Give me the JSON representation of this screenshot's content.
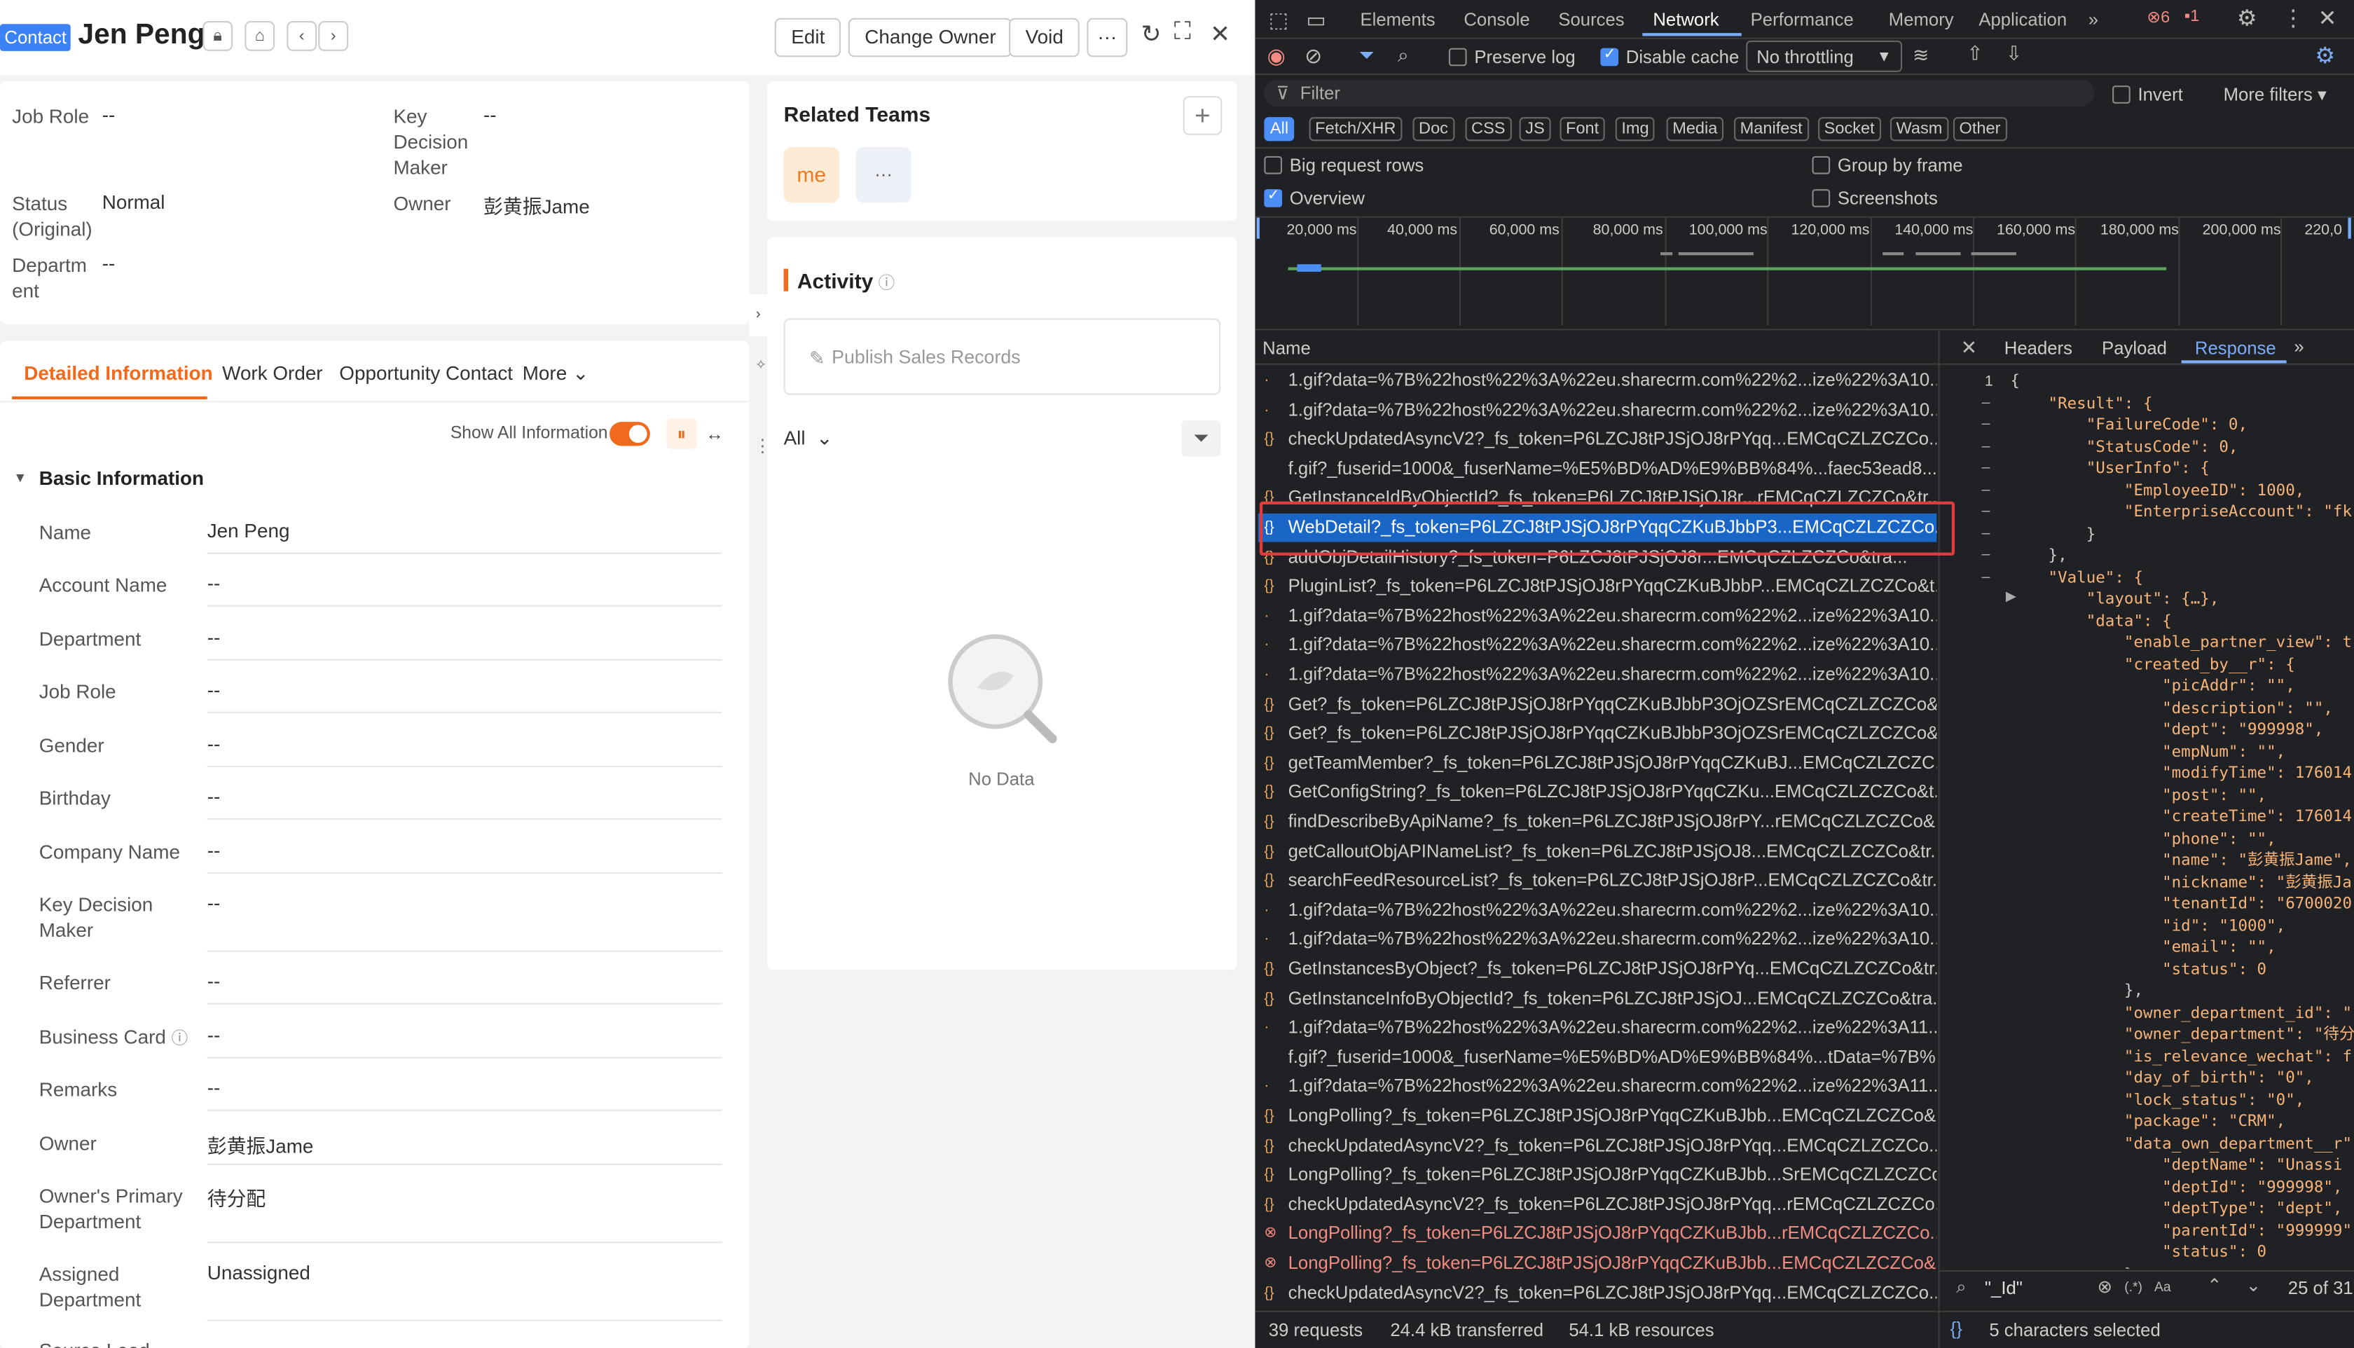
{
  "crm": {
    "type_tag": "Contact",
    "name": "Jen Peng",
    "buttons": {
      "edit": "Edit",
      "change_owner": "Change Owner",
      "void": "Void",
      "more": "···"
    },
    "summary": {
      "job_role_label": "Job Role",
      "job_role_value": "--",
      "key_decision_label": "Key Decision Maker",
      "key_decision_value": "--",
      "status_label": "Status (Original)",
      "status_value": "Normal",
      "owner_label": "Owner",
      "owner_value": "彭黄振Jame",
      "department_label": "Departm ent",
      "department_value": "--"
    },
    "tabs": [
      "Detailed Information",
      "Work Order",
      "Opportunity Contact",
      "More"
    ],
    "show_all_label": "Show All Information",
    "section_title": "Basic Information",
    "fields": [
      {
        "label": "Name",
        "value": "Jen Peng"
      },
      {
        "label": "Account Name",
        "value": "--"
      },
      {
        "label": "Department",
        "value": "--"
      },
      {
        "label": "Job Role",
        "value": "--"
      },
      {
        "label": "Gender",
        "value": "--"
      },
      {
        "label": "Birthday",
        "value": "--"
      },
      {
        "label": "Company Name",
        "value": "--"
      },
      {
        "label": "Key Decision Maker",
        "value": "--"
      },
      {
        "label": "Referrer",
        "value": "--"
      },
      {
        "label": "Business Card",
        "value": "--"
      },
      {
        "label": "Remarks",
        "value": "--"
      },
      {
        "label": "Owner",
        "value": "彭黄振Jame"
      },
      {
        "label": "Owner's Primary Department",
        "value": "待分配"
      },
      {
        "label": "Assigned Department",
        "value": "Unassigned"
      },
      {
        "label": "Source Lead",
        "value": ""
      }
    ],
    "related_teams": {
      "title": "Related Teams",
      "avatar": "me",
      "more": "···",
      "add": "+"
    },
    "activity": {
      "title": "Activity",
      "publish_placeholder": "Publish Sales Records",
      "filter_all": "All",
      "empty": "No Data"
    }
  },
  "devtools": {
    "tabs": [
      "Elements",
      "Console",
      "Sources",
      "Network",
      "Performance",
      "Memory",
      "Application"
    ],
    "active_tab": "Network",
    "badges": {
      "errors": "6",
      "warnings": "1"
    },
    "toolbar": {
      "preserve_log": "Preserve log",
      "disable_cache": "Disable cache",
      "throttling": "No throttling"
    },
    "filter": {
      "placeholder": "Filter",
      "invert": "Invert",
      "more_filters": "More filters"
    },
    "type_filters": [
      "All",
      "Fetch/XHR",
      "Doc",
      "CSS",
      "JS",
      "Font",
      "Img",
      "Media",
      "Manifest",
      "Socket",
      "Wasm",
      "Other"
    ],
    "options": {
      "big_rows": "Big request rows",
      "group_by_frame": "Group by frame",
      "overview": "Overview",
      "screenshots": "Screenshots"
    },
    "timeline_ticks": [
      "20,000 ms",
      "40,000 ms",
      "60,000 ms",
      "80,000 ms",
      "100,000 ms",
      "120,000 ms",
      "140,000 ms",
      "160,000 ms",
      "180,000 ms",
      "200,000 ms",
      "220,0"
    ],
    "list_header": "Name",
    "requests": [
      {
        "name": "1.gif?data=%7B%22host%22%3A%22eu.sharecrm.com%22%2...ize%22%3A10...",
        "kind": "plain"
      },
      {
        "name": "1.gif?data=%7B%22host%22%3A%22eu.sharecrm.com%22%2...ize%22%3A10...",
        "kind": "plain"
      },
      {
        "name": "checkUpdatedAsyncV2?_fs_token=P6LZCJ8tPJSjOJ8rPYqq...EMCqCZLZCZCo...",
        "kind": "xhr"
      },
      {
        "name": "f.gif?_fuserid=1000&_fuserName=%E5%BD%AD%E9%BB%84%...faec53ead8...",
        "kind": "plain"
      },
      {
        "name": "GetInstanceIdByObjectId?_fs_token=P6LZCJ8tPJSjOJ8r...rEMCqCZLZCZCo&tr...",
        "kind": "xhr"
      },
      {
        "name": "WebDetail?_fs_token=P6LZCJ8tPJSjOJ8rPYqqCZKuBJbbP3...EMCqCZLZCZCo...",
        "kind": "selected"
      },
      {
        "name": "addObjDetailHistory?_fs_token=P6LZCJ8tPJSjOJ8r...EMCqCZLZCZCo&tra...",
        "kind": "xhr"
      },
      {
        "name": "PluginList?_fs_token=P6LZCJ8tPJSjOJ8rPYqqCZKuBJbbP...EMCqCZLZCZCo&t...",
        "kind": "xhr"
      },
      {
        "name": "1.gif?data=%7B%22host%22%3A%22eu.sharecrm.com%22%2...ize%22%3A10...",
        "kind": "plain"
      },
      {
        "name": "1.gif?data=%7B%22host%22%3A%22eu.sharecrm.com%22%2...ize%22%3A10...",
        "kind": "plain"
      },
      {
        "name": "1.gif?data=%7B%22host%22%3A%22eu.sharecrm.com%22%2...ize%22%3A10...",
        "kind": "plain"
      },
      {
        "name": "Get?_fs_token=P6LZCJ8tPJSjOJ8rPYqqCZKuBJbbP3OjOZSrEMCqCZLZCZCo&...",
        "kind": "xhr"
      },
      {
        "name": "Get?_fs_token=P6LZCJ8tPJSjOJ8rPYqqCZKuBJbbP3OjOZSrEMCqCZLZCZCo&...",
        "kind": "xhr"
      },
      {
        "name": "getTeamMember?_fs_token=P6LZCJ8tPJSjOJ8rPYqqCZKuBJ...EMCqCZLZCZC...",
        "kind": "xhr"
      },
      {
        "name": "GetConfigString?_fs_token=P6LZCJ8tPJSjOJ8rPYqqCZKu...EMCqCZLZCZCo&t...",
        "kind": "xhr"
      },
      {
        "name": "findDescribeByApiName?_fs_token=P6LZCJ8tPJSjOJ8rPY...rEMCqCZLZCZCo&...",
        "kind": "xhr"
      },
      {
        "name": "getCalloutObjAPINameList?_fs_token=P6LZCJ8tPJSjOJ8...EMCqCZLZCZCo&tr...",
        "kind": "xhr"
      },
      {
        "name": "searchFeedResourceList?_fs_token=P6LZCJ8tPJSjOJ8rP...EMCqCZLZCZCo&tr...",
        "kind": "xhr"
      },
      {
        "name": "1.gif?data=%7B%22host%22%3A%22eu.sharecrm.com%22%2...ize%22%3A10...",
        "kind": "plain"
      },
      {
        "name": "1.gif?data=%7B%22host%22%3A%22eu.sharecrm.com%22%2...ize%22%3A10...",
        "kind": "plain"
      },
      {
        "name": "GetInstancesByObject?_fs_token=P6LZCJ8tPJSjOJ8rPYq...EMCqCZLZCZCo&tr...",
        "kind": "xhr"
      },
      {
        "name": "GetInstanceInfoByObjectId?_fs_token=P6LZCJ8tPJSjOJ...EMCqCZLZCZCo&tra...",
        "kind": "xhr"
      },
      {
        "name": "1.gif?data=%7B%22host%22%3A%22eu.sharecrm.com%22%2...ize%22%3A11...",
        "kind": "plain"
      },
      {
        "name": "f.gif?_fuserid=1000&_fuserName=%E5%BD%AD%E9%BB%84%...tData=%7B%...",
        "kind": "plain"
      },
      {
        "name": "1.gif?data=%7B%22host%22%3A%22eu.sharecrm.com%22%2...ize%22%3A11...",
        "kind": "plain"
      },
      {
        "name": "LongPolling?_fs_token=P6LZCJ8tPJSjOJ8rPYqqCZKuBJbb...EMCqCZLZCZCo&...",
        "kind": "xhr"
      },
      {
        "name": "checkUpdatedAsyncV2?_fs_token=P6LZCJ8tPJSjOJ8rPYqq...EMCqCZLZCZCo...",
        "kind": "xhr"
      },
      {
        "name": "LongPolling?_fs_token=P6LZCJ8tPJSjOJ8rPYqqCZKuBJbb...SrEMCqCZLZCZCo...",
        "kind": "xhr"
      },
      {
        "name": "checkUpdatedAsyncV2?_fs_token=P6LZCJ8tPJSjOJ8rPYqq...rEMCqCZLZCZCo...",
        "kind": "xhr"
      },
      {
        "name": "LongPolling?_fs_token=P6LZCJ8tPJSjOJ8rPYqqCZKuBJbb...rEMCqCZLZCZCo...",
        "kind": "error"
      },
      {
        "name": "LongPolling?_fs_token=P6LZCJ8tPJSjOJ8rPYqqCZKuBJbb...EMCqCZLZCZCo&...",
        "kind": "error"
      },
      {
        "name": "checkUpdatedAsyncV2?_fs_token=P6LZCJ8tPJSjOJ8rPYqq...EMCqCZLZCZCo...",
        "kind": "xhr"
      }
    ],
    "detail_tabs": [
      "Headers",
      "Payload",
      "Response"
    ],
    "active_detail_tab": "Response",
    "json_lines": [
      "{",
      "    \"Result\": {",
      "        \"FailureCode\": 0,",
      "        \"StatusCode\": 0,",
      "        \"UserInfo\": {",
      "            \"EmployeeID\": 1000,",
      "            \"EnterpriseAccount\": \"fk",
      "        }",
      "    },",
      "    \"Value\": {",
      "        \"layout\": {…},",
      "        \"data\": {",
      "            \"enable_partner_view\": t",
      "            \"created_by__r\": {",
      "                \"picAddr\": \"\",",
      "                \"description\": \"\",",
      "                \"dept\": \"999998\",",
      "                \"empNum\": \"\",",
      "                \"modifyTime\": 176014",
      "                \"post\": \"\",",
      "                \"createTime\": 176014",
      "                \"phone\": \"\",",
      "                \"name\": \"彭黄振Jame\",",
      "                \"nickname\": \"彭黄振Ja",
      "                \"tenantId\": \"6700020",
      "                \"id\": \"1000\",",
      "                \"email\": \"\",",
      "                \"status\": 0",
      "            },",
      "            \"owner_department_id\": \"",
      "            \"owner_department\": \"待分",
      "            \"is_relevance_wechat\": f",
      "            \"day_of_birth\": \"0\",",
      "            \"lock_status\": \"0\",",
      "            \"package\": \"CRM\",",
      "            \"data_own_department__r\"",
      "                \"deptName\": \"Unassi",
      "                \"deptId\": \"999998\",",
      "                \"deptType\": \"dept\",",
      "                \"parentId\": \"999999\"",
      "                \"status\": 0",
      "            },"
    ],
    "search": {
      "query": "\"_Id\"",
      "case": "Aa",
      "regex": "(.*)",
      "count": "25 of 31"
    },
    "status_bar": {
      "requests": "39 requests",
      "transferred": "24.4 kB transferred",
      "resources": "54.1 kB resources",
      "selection": "5 characters selected"
    }
  }
}
